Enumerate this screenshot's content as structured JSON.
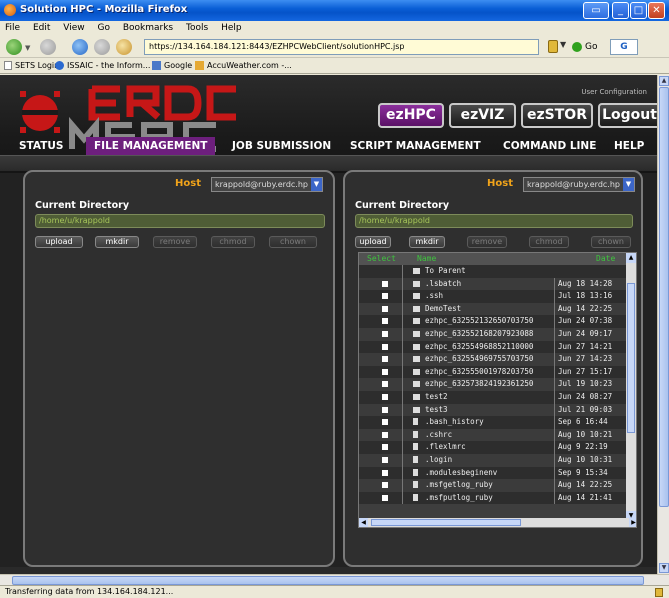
{
  "window": {
    "title": "Solution HPC - Mozilla Firefox"
  },
  "menu": [
    "File",
    "Edit",
    "View",
    "Go",
    "Bookmarks",
    "Tools",
    "Help"
  ],
  "nav": {
    "url": "https://134.164.184.121:8443/EZHPCWebClient/solutionHPC.jsp",
    "go_label": "Go"
  },
  "bookmarks": [
    "SETS Login",
    "ISSAIC - the Inform...",
    "Google",
    "AccuWeather.com -..."
  ],
  "header": {
    "user_config": "User Configuration",
    "buttons": [
      "ezHPC",
      "ezVIZ",
      "ezSTOR",
      "Logout"
    ],
    "tabs": [
      "STATUS",
      "FILE MANAGEMENT",
      "JOB SUBMISSION",
      "SCRIPT MANAGEMENT",
      "COMMAND LINE",
      "HELP"
    ],
    "active_tab": "FILE MANAGEMENT",
    "accent_purple": "#6d1f7d"
  },
  "left_panel": {
    "host_label": "Host",
    "host_value": "krappold@ruby.erdc.hp",
    "current_dir_label": "Current Directory",
    "current_dir": "/home/u/krappold",
    "actions": [
      "upload",
      "mkdir",
      "remove",
      "chmod",
      "chown"
    ]
  },
  "right_panel": {
    "host_label": "Host",
    "host_value": "krappold@ruby.erdc.hp",
    "current_dir_label": "Current Directory",
    "current_dir": "/home/u/krappold",
    "actions": [
      "upload",
      "mkdir",
      "remove",
      "chmod",
      "chown"
    ],
    "table_headers": {
      "select": "Select",
      "name": "Name",
      "date": "Date"
    },
    "files": [
      {
        "name": "To Parent",
        "date": "",
        "type": "parent"
      },
      {
        "name": ".lsbatch",
        "date": "Aug 18 14:28",
        "type": "dir"
      },
      {
        "name": ".ssh",
        "date": "Jul 18 13:16",
        "type": "dir"
      },
      {
        "name": "DemoTest",
        "date": "Aug 14 22:25",
        "type": "dir"
      },
      {
        "name": "ezhpc_632552132650703750",
        "date": "Jun 24 07:38",
        "type": "dir"
      },
      {
        "name": "ezhpc_632552168207923088",
        "date": "Jun 24 09:17",
        "type": "dir"
      },
      {
        "name": "ezhpc_632554968852110000",
        "date": "Jun 27 14:21",
        "type": "dir"
      },
      {
        "name": "ezhpc_632554969755703750",
        "date": "Jun 27 14:23",
        "type": "dir"
      },
      {
        "name": "ezhpc_632555001978203750",
        "date": "Jun 27 15:17",
        "type": "dir"
      },
      {
        "name": "ezhpc_632573824192361250",
        "date": "Jul 19 10:23",
        "type": "dir"
      },
      {
        "name": "test2",
        "date": "Jun 24 08:27",
        "type": "dir"
      },
      {
        "name": "test3",
        "date": "Jul 21 09:03",
        "type": "dir"
      },
      {
        "name": ".bash_history",
        "date": "Sep 6 16:44",
        "type": "file"
      },
      {
        "name": ".cshrc",
        "date": "Aug 10 10:21",
        "type": "file"
      },
      {
        "name": ".flexlmrc",
        "date": "Aug 9 22:19",
        "type": "file"
      },
      {
        "name": ".login",
        "date": "Aug 10 10:31",
        "type": "file"
      },
      {
        "name": ".modulesbeginenv",
        "date": "Sep 9 15:34",
        "type": "file"
      },
      {
        "name": ".msfgetlog_ruby",
        "date": "Aug 14 22:25",
        "type": "file"
      },
      {
        "name": ".msfputlog_ruby",
        "date": "Aug 14 21:41",
        "type": "file"
      }
    ]
  },
  "status_bar": "Transferring data from 134.164.184.121..."
}
